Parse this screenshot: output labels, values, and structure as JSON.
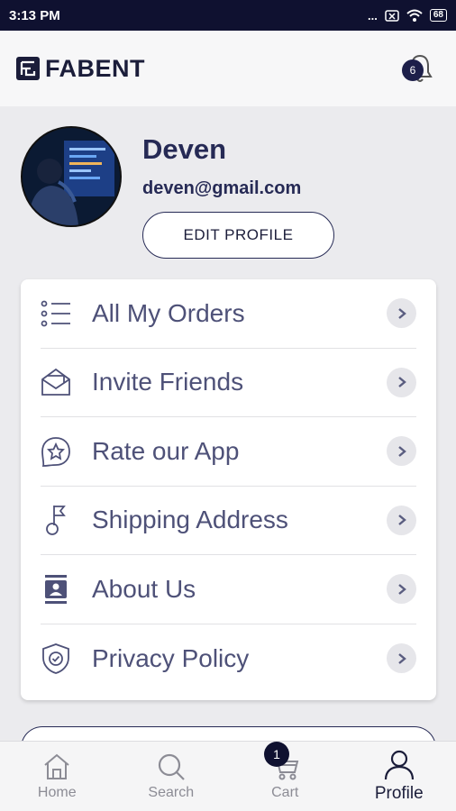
{
  "status_bar": {
    "time": "3:13 PM",
    "dots": "...",
    "battery": "68"
  },
  "app_bar": {
    "brand": "FABENT",
    "notification_count": "6"
  },
  "profile": {
    "name": "Deven",
    "email": "deven@gmail.com",
    "edit_label": "EDIT PROFILE"
  },
  "menu": {
    "items": [
      {
        "label": "All My Orders",
        "icon": "list-icon"
      },
      {
        "label": "Invite Friends",
        "icon": "envelope-icon"
      },
      {
        "label": "Rate our App",
        "icon": "star-badge-icon"
      },
      {
        "label": "Shipping Address",
        "icon": "flag-pin-icon"
      },
      {
        "label": "About Us",
        "icon": "contact-card-icon"
      },
      {
        "label": "Privacy Policy",
        "icon": "shield-check-icon"
      }
    ]
  },
  "tabs": [
    {
      "label": "Home",
      "icon": "home-icon"
    },
    {
      "label": "Search",
      "icon": "search-icon"
    },
    {
      "label": "Cart",
      "icon": "cart-icon",
      "badge": "1"
    },
    {
      "label": "Profile",
      "icon": "user-icon",
      "active": true
    }
  ],
  "colors": {
    "primary": "#262a55",
    "status_bar": "#0f1130",
    "background": "#ebebee"
  }
}
